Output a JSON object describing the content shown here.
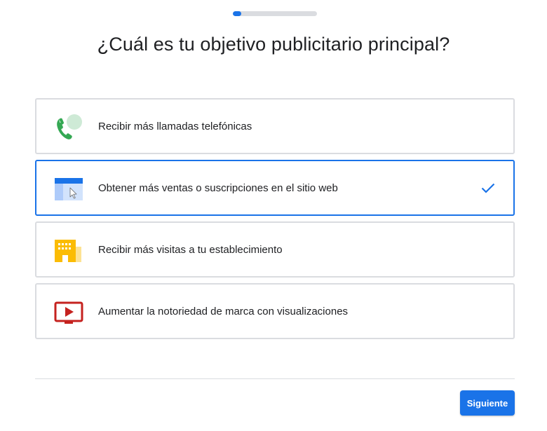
{
  "progress": {
    "value_percent": 10
  },
  "title": "¿Cuál es tu objetivo publicitario principal?",
  "options": [
    {
      "label": "Recibir más llamadas telefónicas",
      "icon": "phone-call-icon",
      "selected": false
    },
    {
      "label": "Obtener más ventas o suscripciones en el sitio web",
      "icon": "website-click-icon",
      "selected": true
    },
    {
      "label": "Recibir más visitas a tu establecimiento",
      "icon": "storefront-icon",
      "selected": false
    },
    {
      "label": "Aumentar la notoriedad de marca con visualizaciones",
      "icon": "video-play-icon",
      "selected": false
    }
  ],
  "footer": {
    "next_label": "Siguiente"
  },
  "colors": {
    "accent": "#1a73e8",
    "border": "#dadce0",
    "phone_green": "#34a853",
    "store_yellow": "#fbbc04",
    "video_red": "#c5221f"
  }
}
